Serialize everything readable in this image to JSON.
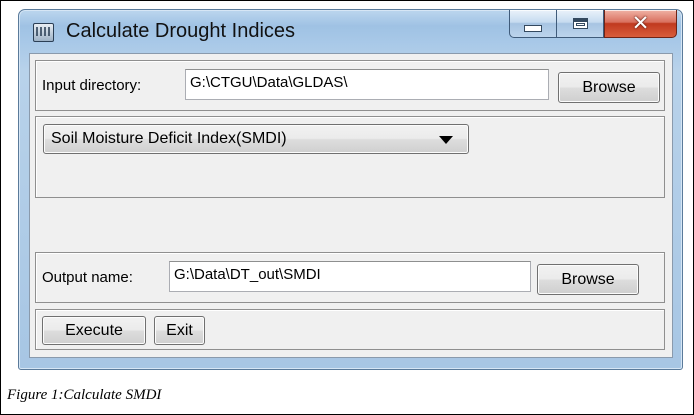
{
  "window": {
    "title": "Calculate Drought Indices",
    "icon": "app-window-icon",
    "controls": {
      "minimize": "minimize-icon",
      "maximize": "maximize-icon",
      "close": "close-icon"
    }
  },
  "input": {
    "label": "Input directory:",
    "value": "G:\\CTGU\\Data\\GLDAS\\",
    "browse_label": "Browse"
  },
  "index_select": {
    "selected": "Soil Moisture Deficit Index(SMDI)"
  },
  "output": {
    "label": "Output name:",
    "value": "G:\\Data\\DT_out\\SMDI",
    "browse_label": "Browse"
  },
  "actions": {
    "execute_label": "Execute",
    "exit_label": "Exit"
  },
  "caption": "Figure 1:Calculate SMDI",
  "colors": {
    "window_frame": "#a9c9e8",
    "client_bg": "#f0f0f0",
    "close_button": "#c0391f"
  }
}
